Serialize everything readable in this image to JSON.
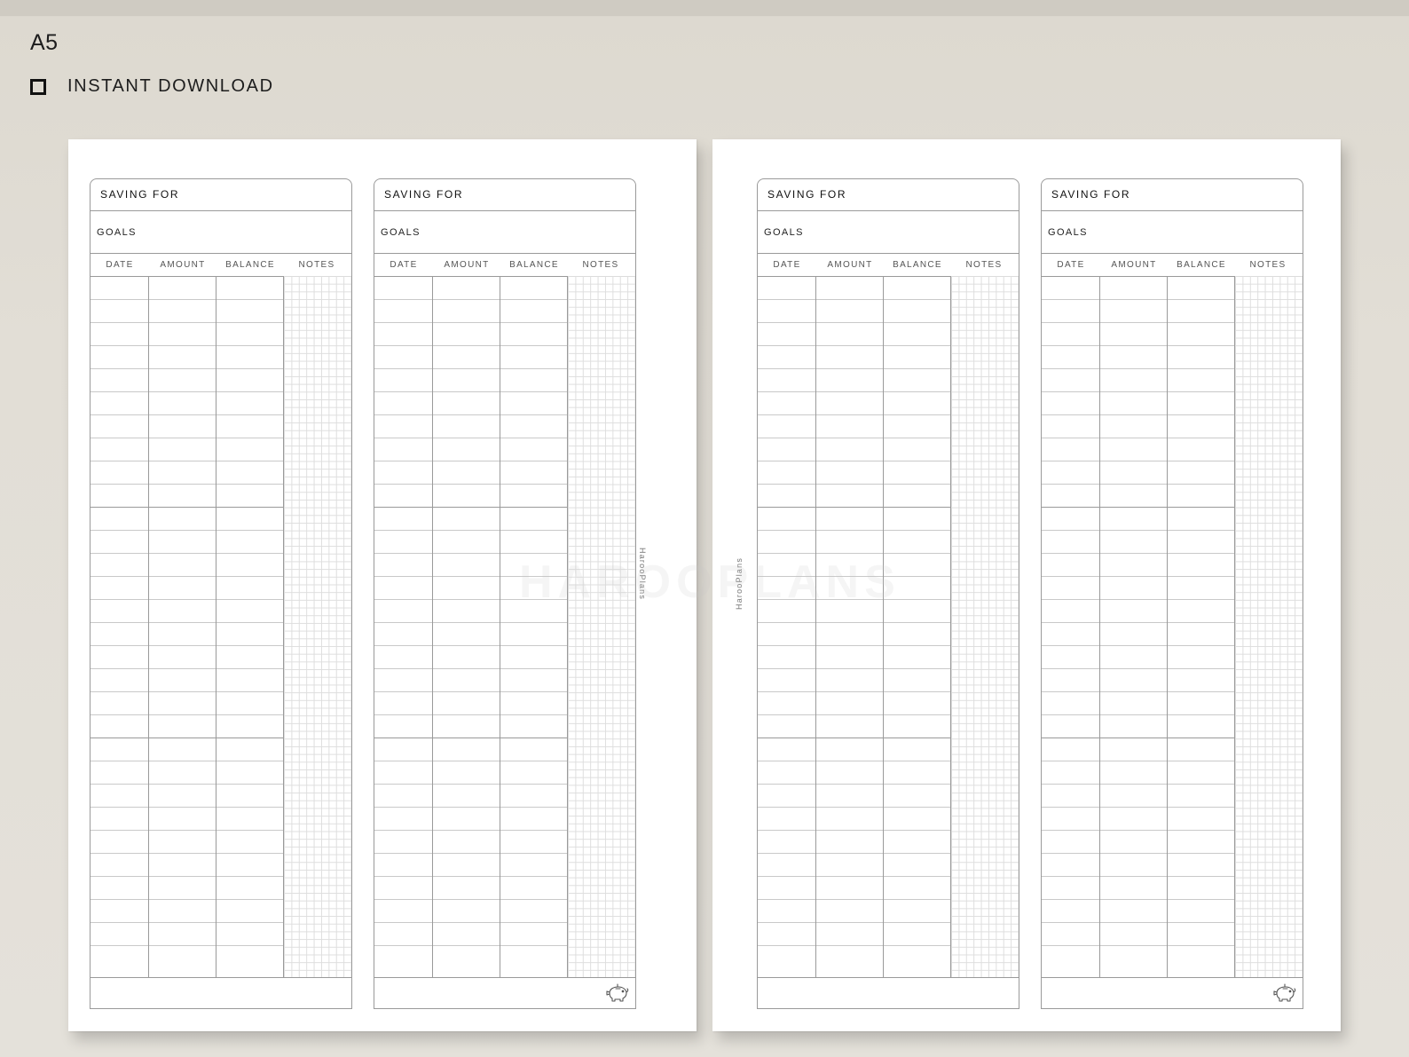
{
  "header": {
    "size_label": "A5",
    "feature_icon": "checkbox-icon",
    "feature_label": "INSTANT DOWNLOAD"
  },
  "sheet_labels": {
    "title": "SAVING FOR",
    "goals": "GOALS",
    "columns": [
      "DATE",
      "AMOUNT",
      "BALANCE",
      "NOTES"
    ]
  },
  "pages": [
    {
      "brand": "HarooPlans",
      "sheets": [
        {
          "has_piggy_icon": false
        },
        {
          "has_piggy_icon": true
        }
      ]
    },
    {
      "brand": "HarooPlans",
      "sheets": [
        {
          "has_piggy_icon": false
        },
        {
          "has_piggy_icon": true
        }
      ]
    }
  ],
  "watermark": "HAROOPLANS",
  "colors": {
    "background": "#e2ded6",
    "paper": "#ffffff",
    "rule": "#9a9a9a",
    "grid": "#dedede"
  }
}
